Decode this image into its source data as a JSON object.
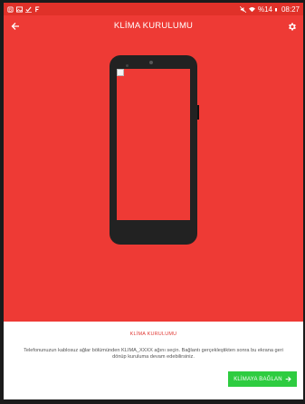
{
  "status_bar": {
    "battery_text": "%14",
    "time": "08:27",
    "icons_left": [
      "b-icon",
      "image-icon",
      "check-icon",
      "f-icon"
    ],
    "icons_right": [
      "mute-icon",
      "wifi-icon",
      "battery-icon"
    ]
  },
  "app_bar": {
    "title": "KLİMA KURULUMU",
    "back_icon": "arrow-left-icon",
    "settings_icon": "gear-icon"
  },
  "illustration": {
    "phone_icon": "phone-icon",
    "image_placeholder": "broken-image-icon"
  },
  "bottom_panel": {
    "section_label": "KLİMA KURULUMU",
    "instructions": "Telefonunuzun kablosuz ağlar bölümünden KLIMA_XXXX ağını seçin. Bağlantı gerçekleştikten sonra bu ekrana geri dönüp kuruluma devam edebilirsiniz.",
    "connect_button": "KLİMAYA BAĞLAN"
  },
  "colors": {
    "primary_red": "#ee3a35",
    "accent_green": "#2ecc40",
    "text_gray": "#555555"
  }
}
